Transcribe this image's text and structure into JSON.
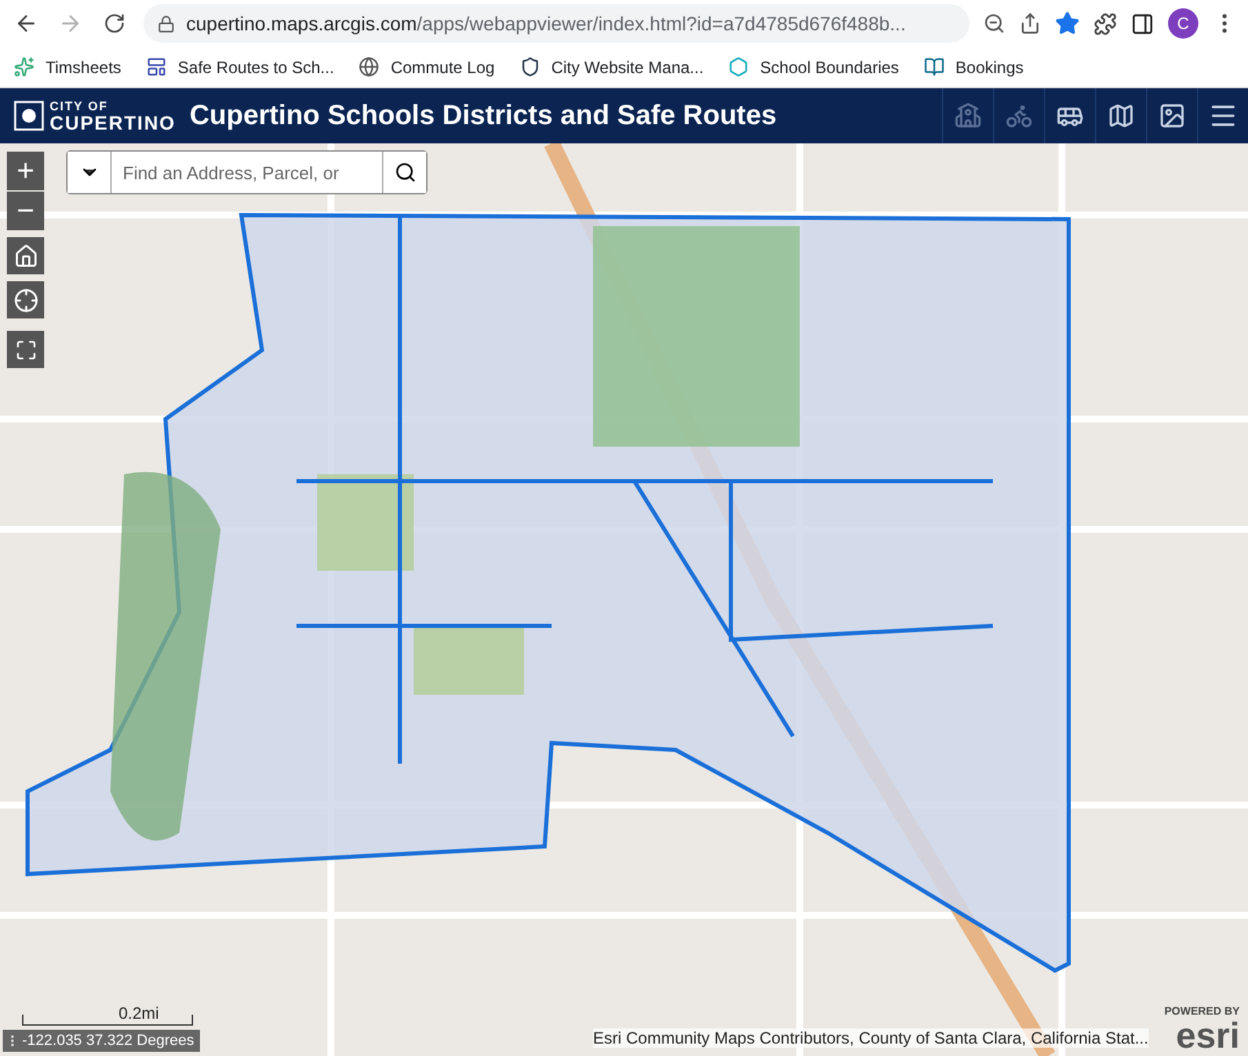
{
  "browser": {
    "url_host": "cupertino.maps.arcgis.com",
    "url_path": "/apps/webappviewer/index.html?id=a7d4785d676f488b...",
    "bookmarked": true,
    "profile_initial": "C",
    "bookmarks": [
      {
        "label": "Timsheets",
        "kind": "sparkle"
      },
      {
        "label": "Safe Routes to Sch...",
        "kind": "form"
      },
      {
        "label": "Commute Log",
        "kind": "globe"
      },
      {
        "label": "City Website Mana...",
        "kind": "badge"
      },
      {
        "label": "School Boundaries",
        "kind": "hex"
      },
      {
        "label": "Bookings",
        "kind": "bookings"
      }
    ]
  },
  "header": {
    "logo_top": "CITY OF",
    "logo_bottom": "CUPERTINO",
    "title": "Cupertino Schools Districts and Safe Routes",
    "tools": [
      {
        "kind": "school",
        "disabled": true
      },
      {
        "kind": "bike",
        "disabled": true
      },
      {
        "kind": "bus",
        "disabled": false
      },
      {
        "kind": "map",
        "disabled": false
      },
      {
        "kind": "image",
        "disabled": false
      },
      {
        "kind": "menu",
        "disabled": false
      }
    ]
  },
  "map": {
    "search": {
      "placeholder": "Find an Address, Parcel, or"
    },
    "zoom_in": "+",
    "zoom_out": "−",
    "scale": "0.2mi",
    "coordinates": "-122.035 37.322 Degrees",
    "attribution": "Esri Community Maps Contributors, County of Santa Clara, California Stat...",
    "powered_by": "POWERED BY",
    "esri": "esri"
  }
}
